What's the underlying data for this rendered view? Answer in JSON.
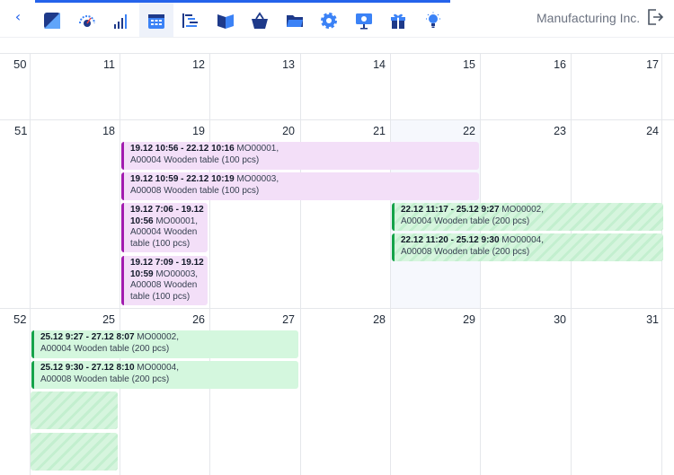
{
  "header": {
    "back_label": "‹",
    "company": "Manufacturing Inc.",
    "tabs": [
      {
        "name": "dashboard-icon",
        "active": false
      },
      {
        "name": "speedometer-icon",
        "active": false
      },
      {
        "name": "bar-signal-icon",
        "active": false
      },
      {
        "name": "calendar-icon",
        "active": true
      },
      {
        "name": "gantt-icon",
        "active": false
      },
      {
        "name": "book-icon",
        "active": false
      },
      {
        "name": "basket-icon",
        "active": false
      },
      {
        "name": "folder-icon",
        "active": false
      },
      {
        "name": "gear-icon",
        "active": false
      },
      {
        "name": "presentation-icon",
        "active": false
      },
      {
        "name": "gift-icon",
        "active": false
      },
      {
        "name": "lightbulb-icon",
        "active": false
      }
    ]
  },
  "calendar": {
    "weeks": [
      {
        "number": "50",
        "days": [
          "11",
          "12",
          "13",
          "14",
          "15",
          "16",
          "17"
        ]
      },
      {
        "number": "51",
        "days": [
          "18",
          "19",
          "20",
          "21",
          "22",
          "23",
          "24"
        ]
      },
      {
        "number": "52",
        "days": [
          "25",
          "26",
          "27",
          "28",
          "29",
          "30",
          "31"
        ]
      }
    ],
    "events": [
      {
        "time": "19.12 10:56 - 22.12 10:16",
        "text": " MO00001,",
        "line2": "A00004 Wooden table (100 pcs)"
      },
      {
        "time": "19.12 10:59 - 22.12 10:19",
        "text": " MO00003,",
        "line2": "A00008 Wooden table (100 pcs)"
      },
      {
        "time": "19.12 7:06 - 19.12",
        "time2": "10:56",
        "text": " MO00001,",
        "line2": "A00004 Wooden",
        "line3": "table (100 pcs)"
      },
      {
        "time": "19.12 7:09 - 19.12",
        "time2": "10:59",
        "text": " MO00003,",
        "line2": "A00008 Wooden",
        "line3": "table (100 pcs)"
      },
      {
        "time": "22.12 11:17 - 25.12 9:27",
        "text": " MO00002,",
        "line2": "A00004 Wooden table (200 pcs)"
      },
      {
        "time": "22.12 11:20 - 25.12 9:30",
        "text": " MO00004,",
        "line2": "A00008 Wooden table (200 pcs)"
      },
      {
        "time": "25.12 9:27 - 27.12 8:07",
        "text": " MO00002,",
        "line2": "A00004 Wooden table (200 pcs)"
      },
      {
        "time": "25.12 9:30 - 27.12 8:10",
        "text": " MO00004,",
        "line2": "A00008 Wooden table (200 pcs)"
      }
    ]
  },
  "colors": {
    "accent": "#2563eb",
    "purple_event": "#f3dff8",
    "purple_border": "#a21caf",
    "green_event": "#d4f7de",
    "green_border": "#16a34a",
    "today_column": "#f6f8fd"
  }
}
